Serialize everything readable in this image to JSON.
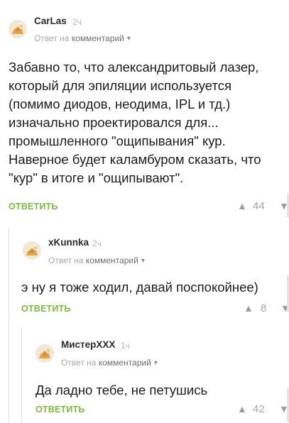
{
  "comments": [
    {
      "username": "CarLas",
      "time": "2ч",
      "reply_prefix": "Ответ на",
      "reply_link": "комментарий",
      "text_lines": [
        "Забавно то, что александритовый лазер,",
        "который для эпиляции используется",
        "(помимо диодов, неодима, IPL и тд.)",
        "изначально проектировался для...",
        "промышленного \"ощипывания\" кур.",
        "Наверное будет каламбуром сказать, что",
        "\"кур\" в итоге и \"ощипывают\"."
      ],
      "reply_label": "ОТВЕТИТЬ",
      "votes": "44"
    },
    {
      "username": "xKunnka",
      "time": "2ч",
      "reply_prefix": "Ответ на",
      "reply_link": "комментарий",
      "text_lines": [
        "э ну я тоже ходил, давай поспокойнее)"
      ],
      "reply_label": "ОТВЕТИТЬ",
      "votes": "8"
    },
    {
      "username": "МистерXXX",
      "time": "1ч",
      "reply_prefix": "Ответ на",
      "reply_link": "комментарий",
      "text_lines": [
        "Да ладно тебе, не петушись"
      ],
      "reply_label": "ОТВЕТИТЬ",
      "votes": "42"
    }
  ],
  "icons": {
    "avatar": "default-avatar-icon",
    "chevron": "chevron-down-icon",
    "vote_up": "vote-up-icon",
    "vote_down": "vote-down-icon"
  },
  "colors": {
    "reply_button": "#7db940",
    "meta_text": "#a9a9a9",
    "thread_line": "#dedede"
  }
}
